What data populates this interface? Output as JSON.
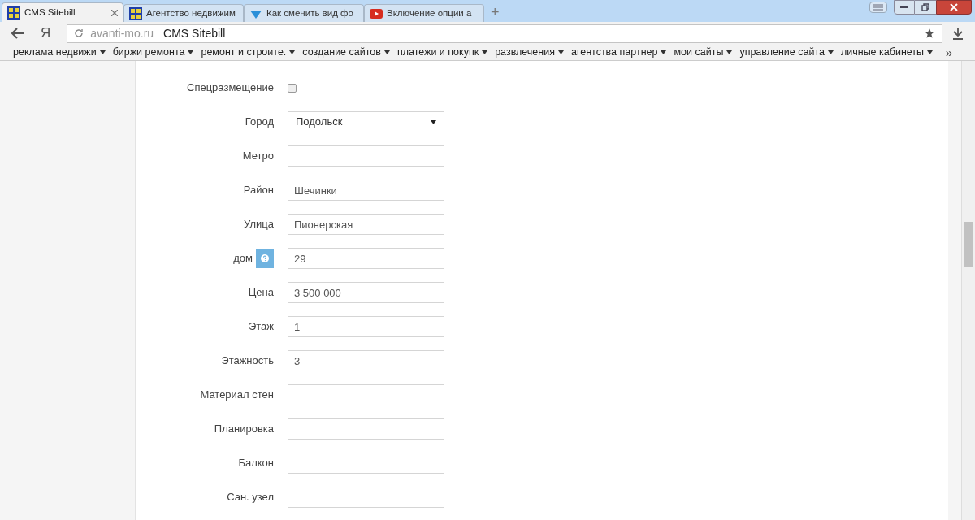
{
  "tabs": [
    {
      "title": "CMS Sitebill",
      "selected": true
    },
    {
      "title": "Агентство недвижим",
      "selected": false
    },
    {
      "title": "Как сменить вид фо",
      "selected": false
    },
    {
      "title": "Включение опции a",
      "selected": false
    }
  ],
  "new_tab": "+",
  "address_bar": {
    "domain": "avanti-mo.ru",
    "title": "CMS Sitebill",
    "back_letter": "Я"
  },
  "bookmarks": [
    "реклама недвижи",
    "биржи ремонта",
    "ремонт и строите.",
    "создание сайтов",
    "платежи и покупк",
    "развлечения",
    "агентства партнер",
    "мои сайты",
    "управление сайта",
    "личные кабинеты"
  ],
  "bookmarks_more": "»",
  "form": [
    {
      "label": "Спецразмещение",
      "kind": "checkbox",
      "checked": false
    },
    {
      "label": "Город",
      "kind": "select",
      "value": "Подольск"
    },
    {
      "label": "Метро",
      "kind": "text"
    },
    {
      "label": "Район",
      "kind": "text",
      "value": "Шечинки"
    },
    {
      "label": "Улица",
      "kind": "text",
      "value": "Пионерская"
    },
    {
      "label": "дом",
      "kind": "text",
      "value": "29",
      "help": true
    },
    {
      "label": "Цена",
      "kind": "text",
      "value": "3 500 000"
    },
    {
      "label": "Этаж",
      "kind": "text",
      "value": "1"
    },
    {
      "label": "Этажность",
      "kind": "text",
      "value": "3"
    },
    {
      "label": "Материал стен",
      "kind": "text"
    },
    {
      "label": "Планировка",
      "kind": "text"
    },
    {
      "label": "Балкон",
      "kind": "text"
    },
    {
      "label": "Сан. узел",
      "kind": "text"
    }
  ]
}
